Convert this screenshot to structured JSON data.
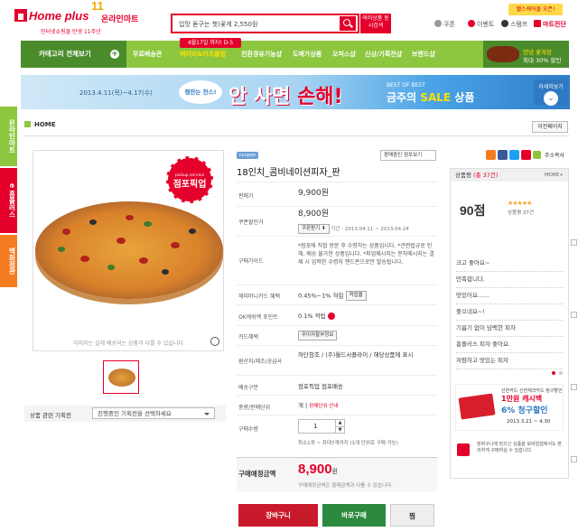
{
  "header": {
    "logo": "Home plus",
    "logo_online": "온라인마트",
    "logo_anniv": "11",
    "logo_sub": "인터넷쇼핑몰 탄생 11주년",
    "search_value": "입맛 돋구는 챗)꽃게 2,550원",
    "multi_search": "여러상품 동시검색",
    "top_badge": "헬스케어몰 오픈!",
    "nav": [
      {
        "label": "쿠폰",
        "color": "#999999"
      },
      {
        "label": "이벤트",
        "color": "#e4002b"
      },
      {
        "label": "스탬프",
        "color": "#333333"
      },
      {
        "label": "마트전단",
        "color": "#e4002b"
      }
    ]
  },
  "menubar": {
    "category_all": "카테고리 전체보기",
    "items": [
      "무료배송관",
      "베이비&키즈클럽",
      "친환경유기농샵",
      "도매가상품",
      "오피스샵",
      "신상/기획전샵",
      "브랜드샵"
    ],
    "active_index": 1,
    "promo_tag": "4월17일 까지! D-5",
    "ad_line1": "양념 꽃게장",
    "ad_line2": "최대 30% 할인"
  },
  "banner": {
    "date": "2013.4.11(목)~4.17(수)",
    "chip": "챙잔는 찬스!",
    "headline_a": "안 사면",
    "headline_b": "손해!",
    "best": "BEST OF BEST",
    "sale": "금주의",
    "sale_em": "SALE",
    "sale_tail": "상품",
    "more": "자세히보기"
  },
  "side_tabs": [
    {
      "label": "온라인마트",
      "color": "#8dc63f"
    },
    {
      "label": "e 홈플러스",
      "color": "#e4002b"
    },
    {
      "label": "백화점관",
      "color": "#f47b20"
    }
  ],
  "breadcrumb": "HOME",
  "prev_page": "이전페이지",
  "product": {
    "stamp_top": "pickup service",
    "stamp_main": "점포픽업",
    "image_note": "이미지는 실제 배송되는 상품과 다를 수 있습니다.",
    "related_label": "상품 관련 기획전",
    "related_select": "진행중인 기획전을 선택하세요",
    "coupon_tag": "coupon",
    "info_select": "판매중인 점포보기",
    "title": "18인치_콤비네이션피자_판",
    "rows": {
      "price_lbl": "판매가",
      "price": "9,900원",
      "coupon_lbl": "쿠폰할인가",
      "coupon_price": "8,900원",
      "coupon_btn": "쿠폰받기",
      "coupon_period": "기간 : 2013.04.11 ~ 2013.04.24",
      "guide_lbl": "구매가이드",
      "guide": "*점포에 직접 방문 후 수령하는 상품입니다. *관련법규로 인해, 배송 불가한 상품입니다. *피업메시지는 문자메시지는 결제 시 입력한 수령자 핸드폰으로만 발송됩니다.",
      "card_lbl": "해피머니카드 혜택",
      "card": "0.45%~1% 적립",
      "card_btn": "적립율",
      "ok_lbl": "OK캐쉬백 포인트",
      "ok": "0.1% 적립",
      "cardben_lbl": "카드혜택",
      "cardben_btn": "무이자할부정보",
      "origin_lbl": "원산지/제조/공급사",
      "origin": "하단참조 / (주)월드서플라이 / 해당상품에 표시",
      "ship_lbl": "배송구분",
      "ship": "점포픽업 점포배송",
      "unit_lbl": "중량/판매단위",
      "unit": "개",
      "unit_btn": "판매단위 안내",
      "qty_lbl": "구매수량",
      "qty": "1",
      "qty_note": "최소1개 ~ 최대7개까지 (1개 단위로 구매 가능)"
    },
    "total_lbl": "구매예정금액",
    "total": "8,900",
    "total_unit": "원",
    "total_note": "구매예정금액은 결제금액과 다를 수 있습니다.",
    "btn_cart": "장바구니",
    "btn_buy": "바로구매",
    "btn_wish": "찜"
  },
  "rightcol": {
    "share": "주소복사",
    "review_title": "상품평",
    "review_count": "(총 37건)",
    "more": "MORE+",
    "score": "90점",
    "stars": "★★★★★",
    "score_sub": "상품평 37건",
    "reviews": [
      "크고 좋아요~",
      "만족합니다.",
      "맛있어요......",
      "좋으네요~!",
      "기름기 없이 담백한 피자",
      "홈플러스 피자 좋아요.",
      "저렴하고 맛있는 피자"
    ],
    "ad1_bank": "신한카드",
    "ad1_note": "신한체크카드 청구할인",
    "ad1_big": "1만원 캐시백",
    "ad1_pct": "6% 청구할인",
    "ad1_date": "2013.3.21 ~ 4.30",
    "ad2": "장바구니에 담으신 상품을 모바일앱에서도 편리하게 구매하실 수 있습니다."
  }
}
